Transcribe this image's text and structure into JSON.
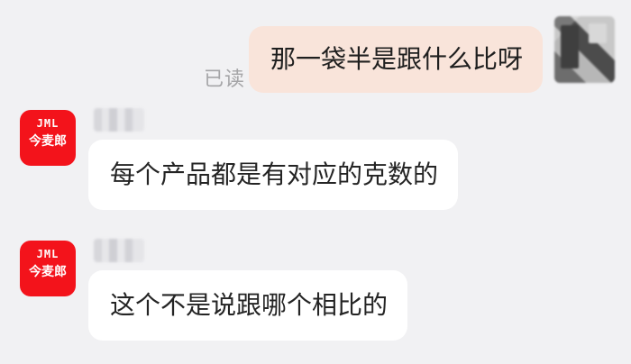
{
  "conversation": {
    "outgoing_message": {
      "text": "那一袋半是跟什么比呀",
      "read_status": "已读"
    },
    "incoming_messages": [
      {
        "text": "每个产品都是有对应的克数的",
        "avatar_brand_top": "JML",
        "avatar_brand_bottom": "今麦郎"
      },
      {
        "text": "这个不是说跟哪个相比的",
        "avatar_brand_top": "JML",
        "avatar_brand_bottom": "今麦郎"
      }
    ]
  },
  "colors": {
    "background": "#f1f1f3",
    "outgoing_bubble": "#f9e4da",
    "incoming_bubble": "#ffffff",
    "brand_red": "#f3131b",
    "read_status_text": "#a5a5a7"
  },
  "icons": {
    "self_avatar": "blurred-user-avatar",
    "brand_avatar": "jml-brand-logo"
  }
}
